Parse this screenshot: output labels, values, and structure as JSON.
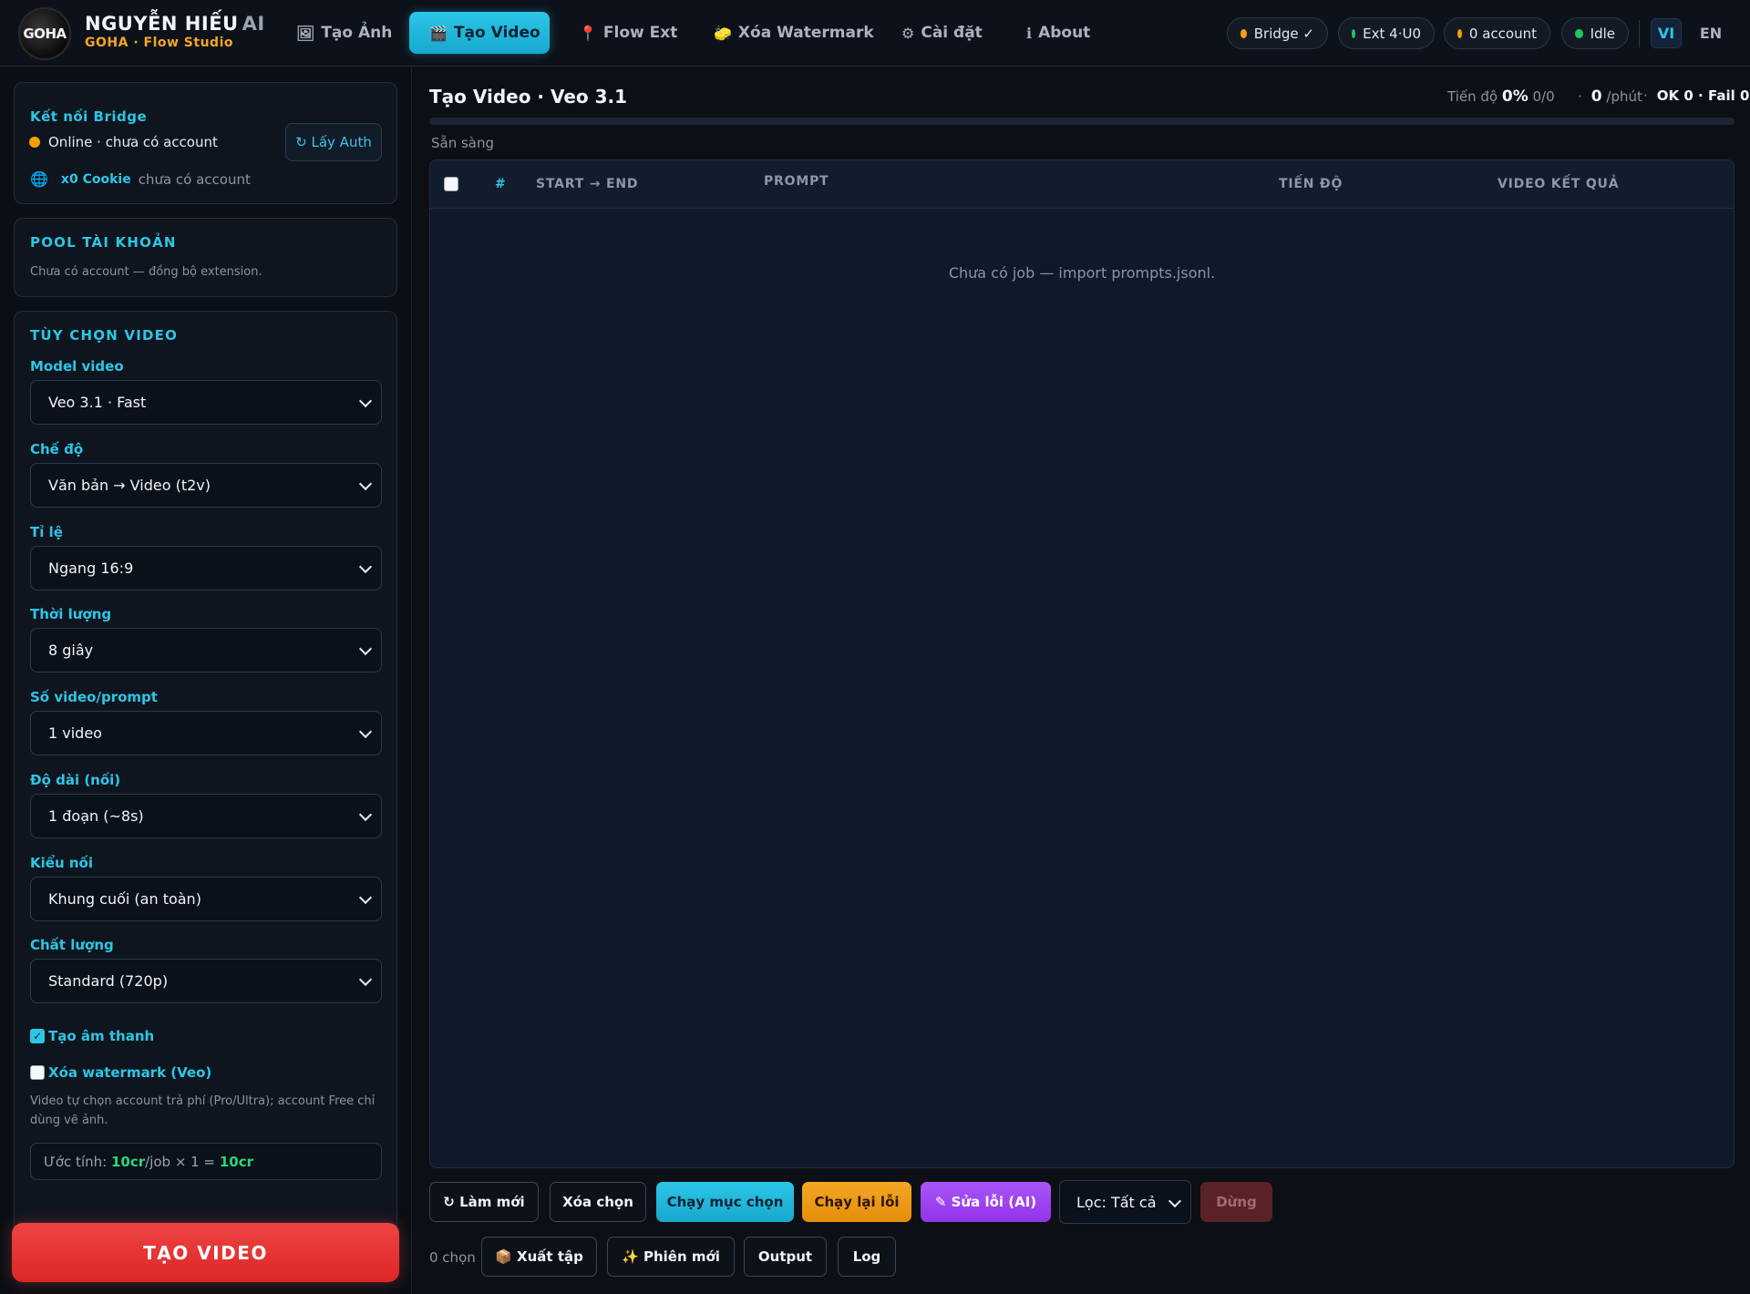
{
  "brand": {
    "logo_text": "GOHA",
    "name": "NGUYỄN HIẾU",
    "name_suffix": "AI",
    "subtitle": "GOHA · Flow Studio"
  },
  "nav": {
    "tabs": [
      {
        "label": "Tạo Ảnh",
        "icon": "image-icon",
        "glyph": "🖼"
      },
      {
        "label": "Tạo Video",
        "icon": "clapper-icon",
        "glyph": "🎬",
        "active": true
      },
      {
        "label": "Flow Ext",
        "icon": "pin-icon",
        "glyph": "📍"
      },
      {
        "label": "Xóa Watermark",
        "icon": "eraser-icon",
        "glyph": "🧽"
      },
      {
        "label": "Cài đặt",
        "icon": "gear-icon",
        "glyph": "⚙"
      },
      {
        "label": "About",
        "icon": "info-icon",
        "glyph": "ℹ"
      }
    ]
  },
  "status": {
    "bridge": "Bridge ✓",
    "ext": "Ext 4·U0",
    "accounts": "0 account",
    "state": "Idle"
  },
  "lang": {
    "vi": "VI",
    "en": "EN",
    "active": "VI"
  },
  "colors": {
    "accent": "#2cc6e6",
    "warning": "#f59e0b",
    "ok": "#22c55e",
    "danger": "#ef4444",
    "purple": "#a855f7"
  },
  "sidebar": {
    "bridge": {
      "title": "Kết nối Bridge",
      "status": "Online · chưa có account",
      "auth_button": "↻ Lấy Auth",
      "cookie_label": "x0 Cookie",
      "cookie_status": "chưa có account"
    },
    "pool": {
      "title": "POOL TÀI KHOẢN",
      "empty": "Chưa có account — đồng bộ extension."
    },
    "video_options": {
      "title": "TÙY CHỌN VIDEO",
      "fields": [
        {
          "label": "Model video",
          "value": "Veo 3.1 · Fast"
        },
        {
          "label": "Chế độ",
          "value": "Văn bản → Video (t2v)"
        },
        {
          "label": "Tỉ lệ",
          "value": "Ngang 16:9"
        },
        {
          "label": "Thời lượng",
          "value": "8 giây"
        },
        {
          "label": "Số video/prompt",
          "value": "1 video"
        },
        {
          "label": "Độ dài (nối)",
          "value": "1 đoạn (~8s)"
        },
        {
          "label": "Kiểu nối",
          "value": "Khung cuối (an toàn)"
        },
        {
          "label": "Chất lượng",
          "value": "Standard (720p)"
        }
      ],
      "audio_label": "Tạo âm thanh",
      "audio_checked": true,
      "watermark_label": "Xóa watermark (Veo)",
      "watermark_checked": false,
      "note": "Video tự chọn account trả phí (Pro/Ultra); account Free chỉ dùng vẽ ảnh.",
      "estimate_prefix": "Ước tính:",
      "estimate_rate": "10cr",
      "estimate_mid": "/job × 1 =",
      "estimate_total": "10cr"
    },
    "create_button": "TẠO VIDEO"
  },
  "main": {
    "title": "Tạo Video · Veo 3.1",
    "progress_label": "Tiến độ",
    "progress_percent": "0%",
    "progress_count": "0/0",
    "progress_fraction": 0,
    "rate_value": "0",
    "rate_unit": "/phút",
    "ok_fail": "OK 0 · Fail 0",
    "status_text": "Sẵn sàng",
    "table": {
      "columns": [
        "#",
        "START → END",
        "PROMPT",
        "TIẾN ĐỘ",
        "VIDEO KẾT QUẢ"
      ],
      "empty_text": "Chưa có job — import prompts.jsonl."
    },
    "actions": {
      "refresh": "↻ Làm mới",
      "delete_selected": "Xóa chọn",
      "run_selected": "Chạy mục chọn",
      "rerun_errors": "Chạy lại lỗi",
      "fix_ai": "✎ Sửa lỗi (AI)",
      "filter": "Lọc: Tất cả",
      "stop": "Dừng",
      "selected_count": "0 chọn",
      "export": "📦 Xuất tập",
      "new_session": "✨ Phiên mới",
      "output": "Output",
      "log": "Log"
    }
  }
}
